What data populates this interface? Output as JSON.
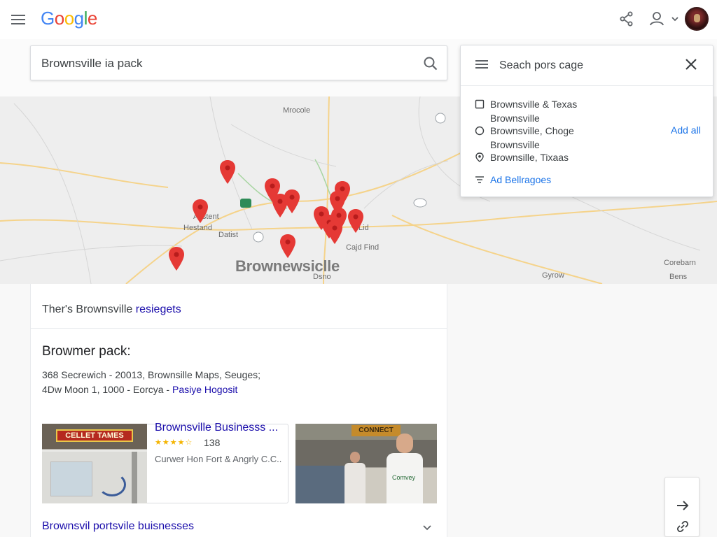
{
  "header": {
    "logo": {
      "G": "G",
      "o1": "o",
      "o2": "o",
      "g": "g",
      "l": "l",
      "e": "e"
    },
    "icons": [
      "menu-icon",
      "share-icon",
      "account-icon",
      "chevron-down-icon",
      "avatar"
    ]
  },
  "search": {
    "value": "Brownsville ia pack"
  },
  "map": {
    "city_label": "Brownewsiclle",
    "labels": [
      "Mrocole",
      "Asstent",
      "Hestand",
      "Datist",
      "Cajd Find",
      "Lid",
      "Dsno",
      "Corebarn",
      "Bens",
      "Gyrow"
    ]
  },
  "panel": {
    "title": "Seach pors cage",
    "rows": [
      {
        "label": "Brownsville & Texas",
        "icon": "checkbox-icon"
      },
      {
        "label": "Brownsville",
        "icon": ""
      },
      {
        "label": "Brownsville, Choge",
        "icon": "radio-icon"
      },
      {
        "label": "Brownsville",
        "icon": ""
      },
      {
        "label": "Brownsille, Tixaas",
        "icon": "location-pin-icon"
      }
    ],
    "add_all": "Add all",
    "link": "Ad Bellragoes"
  },
  "results": {
    "top_text_prefix": "Ther's Brownsville ",
    "top_text_link": "resiegets",
    "pack_title": "Browmer pack:",
    "line1": "368 Secrewich - 20013, Brownsille Maps, Seuges;",
    "line2_prefix": "4Dw Moon 1, 1000 - Eorcya - ",
    "line2_link": "Pasiye Hogosit",
    "business": {
      "thumb_sign": "CELLET TAMES",
      "name": "Brownsville Businesss ...",
      "rating": 4,
      "stars": "★★★★☆",
      "count": "138",
      "address": "Curwer Hon Fort & Angrly C.C.."
    },
    "thumb2_sign": "CONNECT",
    "thumb2_badge": "Comvey",
    "more_label": "Brownsvil portsvile buisnesses"
  },
  "colors": {
    "link": "#1a0dab",
    "accent": "#1a73e8",
    "pin": "#e53935",
    "star": "#f4b400"
  }
}
